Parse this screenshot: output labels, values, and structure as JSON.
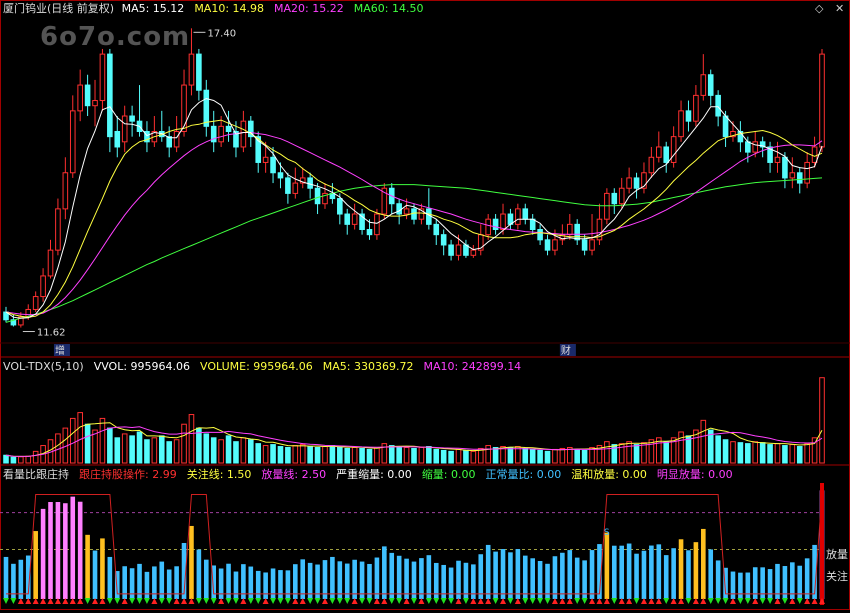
{
  "watermark": "6o7o.com",
  "main": {
    "title": "厦门钨业(日线 前复权)",
    "ma_labels": [
      {
        "text": "MA5: 15.12",
        "color": "#ffffff"
      },
      {
        "text": "MA10: 14.98",
        "color": "#ffff40"
      },
      {
        "text": "MA20: 15.22",
        "color": "#ff40ff"
      },
      {
        "text": "MA60: 14.50",
        "color": "#40ff40"
      }
    ],
    "high_label": "17.40",
    "low_label": "11.62",
    "event_labels": [
      "增",
      "财"
    ]
  },
  "vol": {
    "labels": [
      {
        "text": "VOL-TDX(5,10)",
        "color": "#dddddd"
      },
      {
        "text": "VVOL: 995964.06",
        "color": "#ffffff"
      },
      {
        "text": "VOLUME: 995964.06",
        "color": "#ffff40"
      },
      {
        "text": "MA5: 330369.72",
        "color": "#ffff40"
      },
      {
        "text": "MA10: 242899.14",
        "color": "#ff40ff"
      }
    ]
  },
  "ind": {
    "labels": [
      {
        "text": "看量比跟庄持",
        "color": "#dddddd"
      },
      {
        "text": "跟庄持股操作: 2.99",
        "color": "#ff3030"
      },
      {
        "text": "关注线: 1.50",
        "color": "#ffff40"
      },
      {
        "text": "放量线: 2.50",
        "color": "#ff40ff"
      },
      {
        "text": "严重缩量: 0.00",
        "color": "#ffffff"
      },
      {
        "text": "缩量: 0.00",
        "color": "#40ff40"
      },
      {
        "text": "正常量比: 0.00",
        "color": "#40c0ff"
      },
      {
        "text": "温和放量: 0.00",
        "color": "#ffff40"
      },
      {
        "text": "明显放量: 0.00",
        "color": "#ff40ff"
      }
    ],
    "right_labels": [
      "放量",
      "关注"
    ],
    "s_marker": "S"
  },
  "colors": {
    "up": "#ff3030",
    "down": "#54fcfc",
    "ma5": "#ffffff",
    "ma10": "#ffff40",
    "ma20": "#ff40ff",
    "ma60": "#40ff40",
    "frame": "#a00000"
  },
  "chart_data": {
    "type": "candlestick",
    "ylim": [
      11.3,
      17.6
    ],
    "candles": [
      [
        11.9,
        11.75,
        12.0,
        11.7
      ],
      [
        11.75,
        11.65,
        11.85,
        11.62
      ],
      [
        11.65,
        11.8,
        11.9,
        11.6
      ],
      [
        11.8,
        11.95,
        12.05,
        11.75
      ],
      [
        11.95,
        12.2,
        12.3,
        11.9
      ],
      [
        12.2,
        12.6,
        12.75,
        12.1
      ],
      [
        12.6,
        13.1,
        13.3,
        12.55
      ],
      [
        13.1,
        13.9,
        14.1,
        13.0
      ],
      [
        13.9,
        14.6,
        14.9,
        13.7
      ],
      [
        14.6,
        15.8,
        16.1,
        14.5
      ],
      [
        15.8,
        16.3,
        16.6,
        15.6
      ],
      [
        16.3,
        15.9,
        16.5,
        15.7
      ],
      [
        15.9,
        16.0,
        16.4,
        15.5
      ],
      [
        16.0,
        16.9,
        17.0,
        15.8
      ],
      [
        16.9,
        15.3,
        17.0,
        15.0
      ],
      [
        15.4,
        15.1,
        15.7,
        14.9
      ],
      [
        15.2,
        15.7,
        15.9,
        15.0
      ],
      [
        15.7,
        15.6,
        15.9,
        15.3
      ],
      [
        15.6,
        15.4,
        16.3,
        15.3
      ],
      [
        15.4,
        15.2,
        15.6,
        15.0
      ],
      [
        15.2,
        15.4,
        15.7,
        15.1
      ],
      [
        15.4,
        15.3,
        15.8,
        15.2
      ],
      [
        15.3,
        15.1,
        15.5,
        14.9
      ],
      [
        15.1,
        15.4,
        15.7,
        15.0
      ],
      [
        15.4,
        16.3,
        16.6,
        15.3
      ],
      [
        16.3,
        16.9,
        17.4,
        16.1
      ],
      [
        16.9,
        16.2,
        17.0,
        16.0
      ],
      [
        16.2,
        15.5,
        16.4,
        15.3
      ],
      [
        15.5,
        15.2,
        15.8,
        15.0
      ],
      [
        15.2,
        15.5,
        15.7,
        15.1
      ],
      [
        15.5,
        15.4,
        15.8,
        15.2
      ],
      [
        15.4,
        15.1,
        15.6,
        14.9
      ],
      [
        15.1,
        15.6,
        15.8,
        15.0
      ],
      [
        15.6,
        15.3,
        15.7,
        15.1
      ],
      [
        15.3,
        14.8,
        15.4,
        14.6
      ],
      [
        14.8,
        14.9,
        15.2,
        14.6
      ],
      [
        14.9,
        14.6,
        15.1,
        14.4
      ],
      [
        14.6,
        14.5,
        14.8,
        14.3
      ],
      [
        14.5,
        14.2,
        14.6,
        14.0
      ],
      [
        14.2,
        14.4,
        14.7,
        14.1
      ],
      [
        14.4,
        14.5,
        14.7,
        14.3
      ],
      [
        14.5,
        14.3,
        14.6,
        14.1
      ],
      [
        14.3,
        14.0,
        14.4,
        13.8
      ],
      [
        14.0,
        14.2,
        14.4,
        13.9
      ],
      [
        14.2,
        14.1,
        14.4,
        14.0
      ],
      [
        14.1,
        13.8,
        14.2,
        13.6
      ],
      [
        13.8,
        13.6,
        13.9,
        13.4
      ],
      [
        13.6,
        13.8,
        14.0,
        13.5
      ],
      [
        13.8,
        13.5,
        13.9,
        13.4
      ],
      [
        13.5,
        13.4,
        13.7,
        13.3
      ],
      [
        13.4,
        13.8,
        13.9,
        13.3
      ],
      [
        13.8,
        14.3,
        14.4,
        13.7
      ],
      [
        14.3,
        14.0,
        14.4,
        13.8
      ],
      [
        14.0,
        13.8,
        14.1,
        13.6
      ],
      [
        13.8,
        13.9,
        14.1,
        13.7
      ],
      [
        13.9,
        13.7,
        14.0,
        13.6
      ],
      [
        13.7,
        13.9,
        14.0,
        13.6
      ],
      [
        13.9,
        13.6,
        14.3,
        13.5
      ],
      [
        13.6,
        13.4,
        13.7,
        13.2
      ],
      [
        13.4,
        13.2,
        13.5,
        13.0
      ],
      [
        13.2,
        13.0,
        13.3,
        12.9
      ],
      [
        13.0,
        13.2,
        13.4,
        12.9
      ],
      [
        13.2,
        13.0,
        13.3,
        12.95
      ],
      [
        13.0,
        13.1,
        13.2,
        12.95
      ],
      [
        13.1,
        13.4,
        13.6,
        13.0
      ],
      [
        13.4,
        13.7,
        13.8,
        13.3
      ],
      [
        13.7,
        13.5,
        13.8,
        13.4
      ],
      [
        13.5,
        13.8,
        14.0,
        13.4
      ],
      [
        13.8,
        13.6,
        13.9,
        13.5
      ],
      [
        13.6,
        13.9,
        14.0,
        13.5
      ],
      [
        13.9,
        13.7,
        14.0,
        13.6
      ],
      [
        13.7,
        13.5,
        13.8,
        13.4
      ],
      [
        13.5,
        13.3,
        13.6,
        13.2
      ],
      [
        13.3,
        13.1,
        13.4,
        13.0
      ],
      [
        13.1,
        13.3,
        13.5,
        13.0
      ],
      [
        13.3,
        13.4,
        13.6,
        13.2
      ],
      [
        13.4,
        13.6,
        13.8,
        13.3
      ],
      [
        13.6,
        13.3,
        13.7,
        13.2
      ],
      [
        13.3,
        13.1,
        13.4,
        13.0
      ],
      [
        13.1,
        13.3,
        13.8,
        13.0
      ],
      [
        13.3,
        13.7,
        14.0,
        13.2
      ],
      [
        13.7,
        14.2,
        14.3,
        13.6
      ],
      [
        14.2,
        14.0,
        14.3,
        13.8
      ],
      [
        14.0,
        14.3,
        14.5,
        13.9
      ],
      [
        14.3,
        14.5,
        14.7,
        14.2
      ],
      [
        14.5,
        14.3,
        14.6,
        14.1
      ],
      [
        14.3,
        14.6,
        14.8,
        14.2
      ],
      [
        14.6,
        14.9,
        15.1,
        14.5
      ],
      [
        14.9,
        15.1,
        15.4,
        14.8
      ],
      [
        15.1,
        14.8,
        15.2,
        14.6
      ],
      [
        14.8,
        15.3,
        15.5,
        14.7
      ],
      [
        15.3,
        15.8,
        16.0,
        15.2
      ],
      [
        15.8,
        15.6,
        16.0,
        15.4
      ],
      [
        15.6,
        16.1,
        16.3,
        15.5
      ],
      [
        16.1,
        16.5,
        16.9,
        16.0
      ],
      [
        16.5,
        16.1,
        16.6,
        15.9
      ],
      [
        16.1,
        15.7,
        16.2,
        15.5
      ],
      [
        15.7,
        15.3,
        15.8,
        15.1
      ],
      [
        15.3,
        15.4,
        15.6,
        15.2
      ],
      [
        15.4,
        15.2,
        15.6,
        15.0
      ],
      [
        15.2,
        15.0,
        15.3,
        14.8
      ],
      [
        15.0,
        15.2,
        15.4,
        14.9
      ],
      [
        15.2,
        15.1,
        15.3,
        14.9
      ],
      [
        15.1,
        14.8,
        15.2,
        14.6
      ],
      [
        14.8,
        14.9,
        15.2,
        14.6
      ],
      [
        14.9,
        14.5,
        15.0,
        14.3
      ],
      [
        14.5,
        14.6,
        14.9,
        14.3
      ],
      [
        14.6,
        14.4,
        14.7,
        14.2
      ],
      [
        14.4,
        14.8,
        15.0,
        14.3
      ],
      [
        14.8,
        15.1,
        15.3,
        14.7
      ],
      [
        15.1,
        16.9,
        17.0,
        15.0
      ]
    ],
    "ma5": [
      11.9,
      11.8,
      11.78,
      11.79,
      11.86,
      12.04,
      12.33,
      12.76,
      13.26,
      13.94,
      14.56,
      15.07,
      15.41,
      15.82,
      15.88,
      15.67,
      15.55,
      15.54,
      15.5,
      15.32,
      15.38,
      15.36,
      15.28,
      15.28,
      15.5,
      15.82,
      15.96,
      16.04,
      16.0,
      15.91,
      15.62,
      15.35,
      15.38,
      15.38,
      15.22,
      15.12,
      14.97,
      14.74,
      14.56,
      14.48,
      14.42,
      14.38,
      14.34,
      14.29,
      14.22,
      14.13,
      13.98,
      13.86,
      13.75,
      13.64,
      13.62,
      13.7,
      13.8,
      13.86,
      13.97,
      13.94,
      13.87,
      13.78,
      13.7,
      13.56,
      13.42,
      13.32,
      13.2,
      13.11,
      13.14,
      13.26,
      13.36,
      13.48,
      13.6,
      13.7,
      13.7,
      13.7,
      13.62,
      13.46,
      13.38,
      13.32,
      13.34,
      13.32,
      13.32,
      13.34,
      13.4,
      13.56,
      13.7,
      13.9,
      14.14,
      14.26,
      14.34,
      14.52,
      14.68,
      14.76,
      14.94,
      15.12,
      15.3,
      15.48,
      15.66,
      15.88,
      15.88,
      15.7,
      15.54,
      15.38,
      15.2,
      15.14,
      15.12,
      15.06,
      15.0,
      14.92,
      14.74,
      14.7,
      14.68,
      14.72,
      15.12
    ],
    "ma10": [
      11.9,
      11.85,
      11.82,
      11.8,
      11.82,
      11.9,
      12.04,
      12.24,
      12.48,
      12.78,
      13.12,
      13.46,
      13.78,
      14.1,
      14.44,
      14.72,
      14.96,
      15.1,
      15.2,
      15.24,
      15.3,
      15.34,
      15.4,
      15.44,
      15.46,
      15.52,
      15.54,
      15.58,
      15.6,
      15.62,
      15.56,
      15.5,
      15.44,
      15.36,
      15.26,
      15.14,
      15.04,
      14.96,
      14.86,
      14.8,
      14.68,
      14.58,
      14.46,
      14.38,
      14.32,
      14.24,
      14.16,
      14.06,
      13.98,
      13.88,
      13.82,
      13.78,
      13.76,
      13.76,
      13.78,
      13.82,
      13.82,
      13.8,
      13.76,
      13.7,
      13.66,
      13.6,
      13.52,
      13.44,
      13.4,
      13.36,
      13.34,
      13.34,
      13.34,
      13.36,
      13.4,
      13.42,
      13.44,
      13.42,
      13.4,
      13.38,
      13.36,
      13.36,
      13.36,
      13.34,
      13.36,
      13.42,
      13.48,
      13.58,
      13.7,
      13.8,
      13.9,
      14.02,
      14.14,
      14.28,
      14.44,
      14.58,
      14.72,
      14.84,
      14.98,
      15.1,
      15.22,
      15.28,
      15.32,
      15.36,
      15.38,
      15.4,
      15.42,
      15.38,
      15.32,
      15.24,
      15.14,
      15.06,
      14.98,
      14.92,
      14.98
    ],
    "ma20": [
      11.9,
      11.88,
      11.86,
      11.85,
      11.85,
      11.88,
      11.95,
      12.05,
      12.18,
      12.34,
      12.52,
      12.72,
      12.93,
      13.15,
      13.37,
      13.58,
      13.78,
      13.96,
      14.12,
      14.26,
      14.42,
      14.56,
      14.69,
      14.81,
      14.93,
      15.04,
      15.13,
      15.2,
      15.26,
      15.3,
      15.34,
      15.36,
      15.38,
      15.38,
      15.36,
      15.34,
      15.3,
      15.26,
      15.2,
      15.13,
      15.06,
      14.99,
      14.92,
      14.85,
      14.78,
      14.71,
      14.63,
      14.55,
      14.47,
      14.38,
      14.3,
      14.22,
      14.15,
      14.09,
      14.04,
      14.0,
      13.96,
      13.92,
      13.88,
      13.84,
      13.8,
      13.75,
      13.7,
      13.66,
      13.62,
      13.58,
      13.55,
      13.52,
      13.5,
      13.48,
      13.46,
      13.45,
      13.44,
      13.43,
      13.42,
      13.41,
      13.41,
      13.41,
      13.41,
      13.42,
      13.44,
      13.47,
      13.5,
      13.54,
      13.58,
      13.63,
      13.68,
      13.74,
      13.81,
      13.88,
      13.96,
      14.04,
      14.12,
      14.22,
      14.32,
      14.42,
      14.52,
      14.62,
      14.72,
      14.82,
      14.9,
      14.97,
      15.03,
      15.08,
      15.11,
      15.13,
      15.14,
      15.14,
      15.13,
      15.12,
      15.22
    ],
    "ma60": [
      11.7,
      11.74,
      11.78,
      11.82,
      11.86,
      11.9,
      11.95,
      12.0,
      12.06,
      12.12,
      12.19,
      12.26,
      12.33,
      12.4,
      12.47,
      12.54,
      12.61,
      12.68,
      12.75,
      12.82,
      12.88,
      12.95,
      13.01,
      13.07,
      13.13,
      13.19,
      13.25,
      13.31,
      13.37,
      13.43,
      13.49,
      13.55,
      13.61,
      13.67,
      13.72,
      13.77,
      13.82,
      13.87,
      13.92,
      13.97,
      14.02,
      14.07,
      14.12,
      14.16,
      14.2,
      14.24,
      14.27,
      14.3,
      14.32,
      14.34,
      14.35,
      14.36,
      14.37,
      14.37,
      14.37,
      14.37,
      14.36,
      14.35,
      14.34,
      14.33,
      14.32,
      14.31,
      14.3,
      14.28,
      14.26,
      14.24,
      14.22,
      14.2,
      14.18,
      14.16,
      14.14,
      14.12,
      14.1,
      14.08,
      14.06,
      14.04,
      14.02,
      14.0,
      13.98,
      13.97,
      13.96,
      13.96,
      13.96,
      13.97,
      13.98,
      13.99,
      14.01,
      14.03,
      14.06,
      14.09,
      14.12,
      14.15,
      14.18,
      14.21,
      14.24,
      14.27,
      14.3,
      14.33,
      14.35,
      14.37,
      14.39,
      14.41,
      14.42,
      14.43,
      14.44,
      14.45,
      14.46,
      14.47,
      14.48,
      14.49,
      14.5
    ],
    "volume": [
      40,
      30,
      32,
      35,
      60,
      90,
      120,
      150,
      180,
      230,
      260,
      200,
      170,
      230,
      180,
      130,
      150,
      140,
      160,
      120,
      130,
      140,
      110,
      120,
      200,
      250,
      180,
      150,
      130,
      120,
      140,
      110,
      130,
      120,
      100,
      90,
      95,
      85,
      80,
      90,
      95,
      85,
      80,
      85,
      90,
      80,
      75,
      80,
      75,
      70,
      80,
      100,
      90,
      85,
      80,
      75,
      80,
      85,
      70,
      65,
      60,
      70,
      65,
      60,
      75,
      90,
      80,
      85,
      80,
      85,
      75,
      70,
      65,
      60,
      70,
      75,
      80,
      70,
      65,
      80,
      90,
      110,
      95,
      100,
      110,
      95,
      105,
      120,
      130,
      110,
      130,
      160,
      140,
      170,
      220,
      170,
      140,
      120,
      110,
      105,
      100,
      110,
      105,
      95,
      100,
      90,
      95,
      85,
      100,
      130,
      440
    ],
    "vol_ma5": [
      40,
      35,
      34,
      34,
      39,
      49,
      67,
      91,
      120,
      154,
      186,
      200,
      202,
      206,
      208,
      182,
      172,
      166,
      168,
      140,
      140,
      138,
      132,
      130,
      142,
      164,
      182,
      180,
      183,
      166,
      148,
      134,
      130,
      124,
      120,
      108,
      107,
      98,
      90,
      88,
      89,
      87,
      87,
      85,
      86,
      84,
      82,
      82,
      81,
      78,
      76,
      82,
      85,
      86,
      87,
      86,
      82,
      81,
      78,
      75,
      72,
      70,
      66,
      64,
      66,
      70,
      74,
      78,
      82,
      82,
      80,
      79,
      75,
      71,
      68,
      68,
      70,
      72,
      72,
      74,
      77,
      83,
      88,
      96,
      101,
      102,
      101,
      105,
      112,
      112,
      115,
      130,
      138,
      146,
      164,
      180,
      170,
      164,
      152,
      129,
      115,
      107,
      104,
      102,
      100,
      100,
      97,
      93,
      95,
      100,
      169
    ],
    "vol_ma10": [
      40,
      35,
      34,
      34,
      39,
      45,
      56,
      70,
      85,
      102,
      121,
      137,
      150,
      166,
      180,
      184,
      186,
      183,
      187,
      174,
      162,
      155,
      149,
      149,
      155,
      152,
      156,
      159,
      158,
      158,
      163,
      158,
      153,
      150,
      141,
      133,
      125,
      117,
      111,
      106,
      100,
      97,
      95,
      91,
      90,
      88,
      87,
      85,
      83,
      82,
      81,
      82,
      83,
      83,
      83,
      83,
      82,
      82,
      80,
      78,
      77,
      76,
      74,
      71,
      71,
      72,
      72,
      73,
      73,
      73,
      73,
      72,
      71,
      70,
      69,
      69,
      70,
      71,
      70,
      70,
      71,
      73,
      77,
      81,
      86,
      89,
      93,
      97,
      103,
      106,
      110,
      117,
      123,
      130,
      139,
      147,
      151,
      155,
      158,
      156,
      148,
      140,
      134,
      127,
      117,
      111,
      107,
      104,
      103,
      104,
      128
    ]
  }
}
